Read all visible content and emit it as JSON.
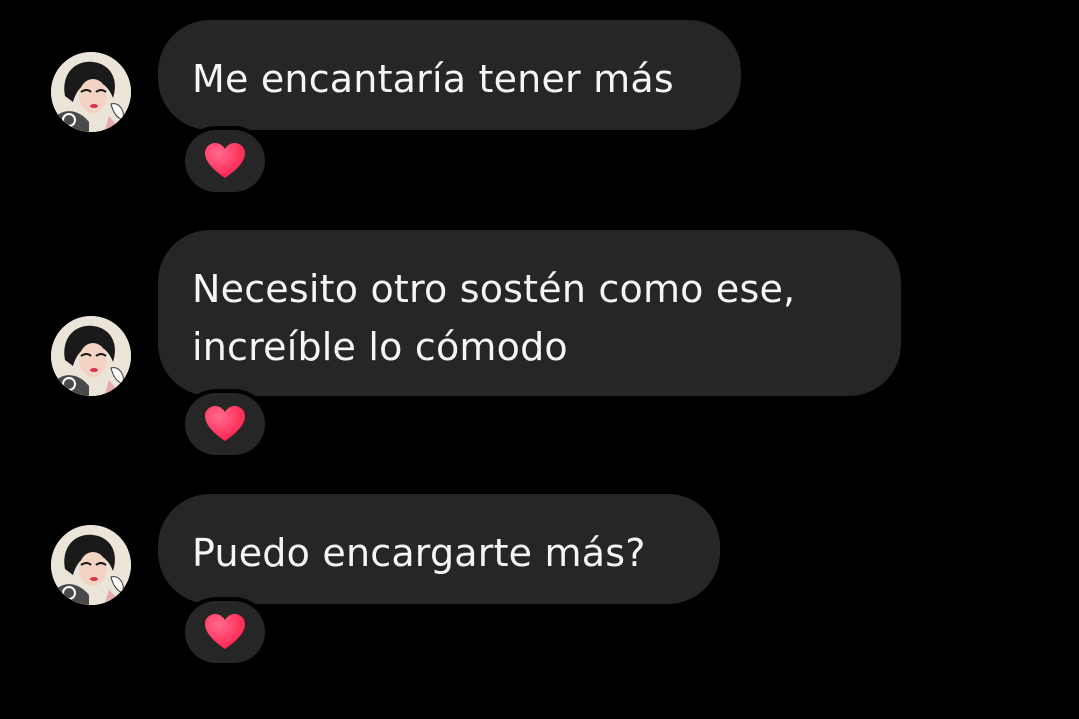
{
  "conversation": {
    "messages": [
      {
        "lines": [
          "Me encantaría tener más"
        ],
        "reaction": "heart-icon"
      },
      {
        "lines": [
          "Necesito otro sostén como ese,",
          "increíble lo cómodo"
        ],
        "reaction": "heart-icon"
      },
      {
        "lines": [
          "Puedo encargarte más?"
        ],
        "reaction": "heart-icon"
      }
    ]
  },
  "colors": {
    "background": "#000000",
    "bubble": "#262626",
    "text": "#f5f5f5",
    "heart": "#ff2d55"
  }
}
